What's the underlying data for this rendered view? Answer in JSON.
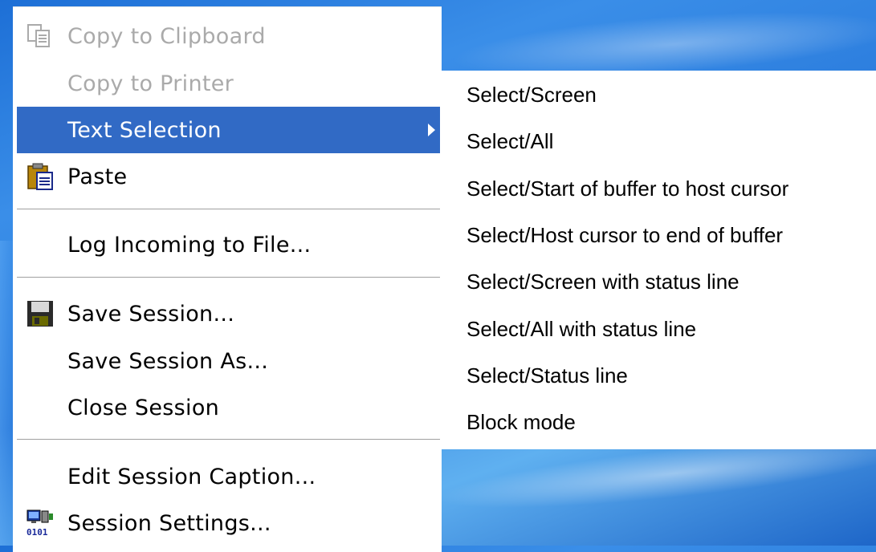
{
  "menu": {
    "items": [
      {
        "label": "Copy to Clipboard",
        "icon": "copy-icon",
        "disabled": true
      },
      {
        "label": "Copy to Printer",
        "icon": null,
        "disabled": true
      },
      {
        "label": "Text Selection",
        "icon": null,
        "highlighted": true,
        "has_submenu": true
      },
      {
        "label": "Paste",
        "icon": "paste-icon"
      },
      {
        "label": "Log Incoming to File...",
        "icon": null
      },
      {
        "label": "Save Session...",
        "icon": "floppy-disk-icon"
      },
      {
        "label": "Save Session As...",
        "icon": null
      },
      {
        "label": "Close Session",
        "icon": null
      },
      {
        "label": "Edit Session Caption...",
        "icon": null
      },
      {
        "label": "Session Settings...",
        "icon": "session-settings-icon"
      }
    ]
  },
  "submenu": {
    "items": [
      {
        "label": "Select/Screen"
      },
      {
        "label": "Select/All"
      },
      {
        "label": "Select/Start of buffer to host cursor"
      },
      {
        "label": "Select/Host cursor to end of buffer"
      },
      {
        "label": "Select/Screen with status line"
      },
      {
        "label": "Select/All with status line"
      },
      {
        "label": "Select/Status line"
      },
      {
        "label": "Block mode"
      }
    ]
  },
  "colors": {
    "highlight": "#316ac5",
    "disabled_text": "#aaaaaa",
    "menu_bg": "#ffffff"
  }
}
